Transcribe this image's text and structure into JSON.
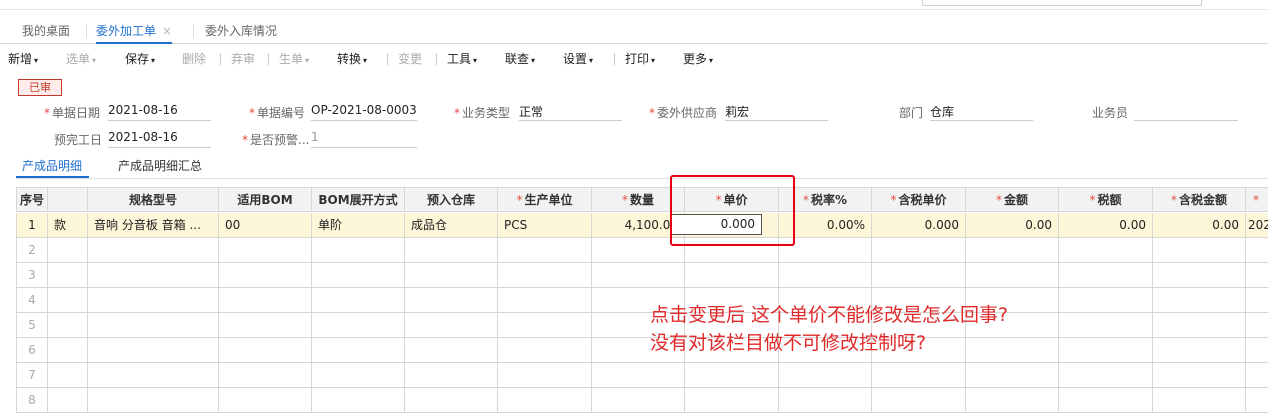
{
  "tabs": [
    {
      "label": "我的桌面"
    },
    {
      "label": "委外加工单",
      "close": "×"
    },
    {
      "label": "委外入库情况"
    }
  ],
  "toolbar": {
    "new": "新增",
    "select": "选单",
    "save": "保存",
    "delete": "删除",
    "abandon": "弃审",
    "generate": "生单",
    "convert": "转换",
    "change": "变更",
    "tools": "工具",
    "query": "联查",
    "settings": "设置",
    "print": "打印",
    "more": "更多",
    "caret": "▾"
  },
  "status_stamp": "已审",
  "form": {
    "date_label": "单据日期",
    "date_value": "2021-08-16",
    "code_label": "单据编号",
    "code_value": "OP-2021-08-0003",
    "biztype_label": "业务类型",
    "biztype_value": "正常",
    "supplier_label": "委外供应商",
    "supplier_value": "莉宏",
    "dept_label": "部门",
    "dept_value": "仓库",
    "clerk_label": "业务员",
    "clerk_value": "",
    "finish_label": "预完工日",
    "finish_value": "2021-08-16",
    "prewarn_label": "是否预警...",
    "prewarn_value": "1"
  },
  "subtabs": [
    "产成品明细",
    "产成品明细汇总"
  ],
  "grid": {
    "columns": [
      "序号",
      "",
      "规格型号",
      "适用BOM",
      "BOM展开方式",
      "预入仓库",
      "生产单位",
      "数量",
      "单价",
      "税率%",
      "含税单价",
      "金额",
      "税额",
      "含税金额",
      ""
    ],
    "row1": {
      "no": "1",
      "name": "款",
      "spec": "音响 分音板 音箱 ...",
      "bom": "00",
      "expand": "单阶",
      "warehouse": "成品仓",
      "unit": "PCS",
      "qty": "4,100.00",
      "price": "0.000",
      "tax_rate": "0.00%",
      "tax_price": "0.000",
      "amount": "0.00",
      "tax": "0.00",
      "tax_amount": "0.00",
      "extra": "202"
    },
    "empty_rows": [
      "2",
      "3",
      "4",
      "5",
      "6",
      "7",
      "8"
    ]
  },
  "annotation": {
    "line1": "点击变更后 这个单价不能修改是怎么回事?",
    "line2": "没有对该栏目做不可修改控制呀?",
    "color": "#e02a2a"
  }
}
